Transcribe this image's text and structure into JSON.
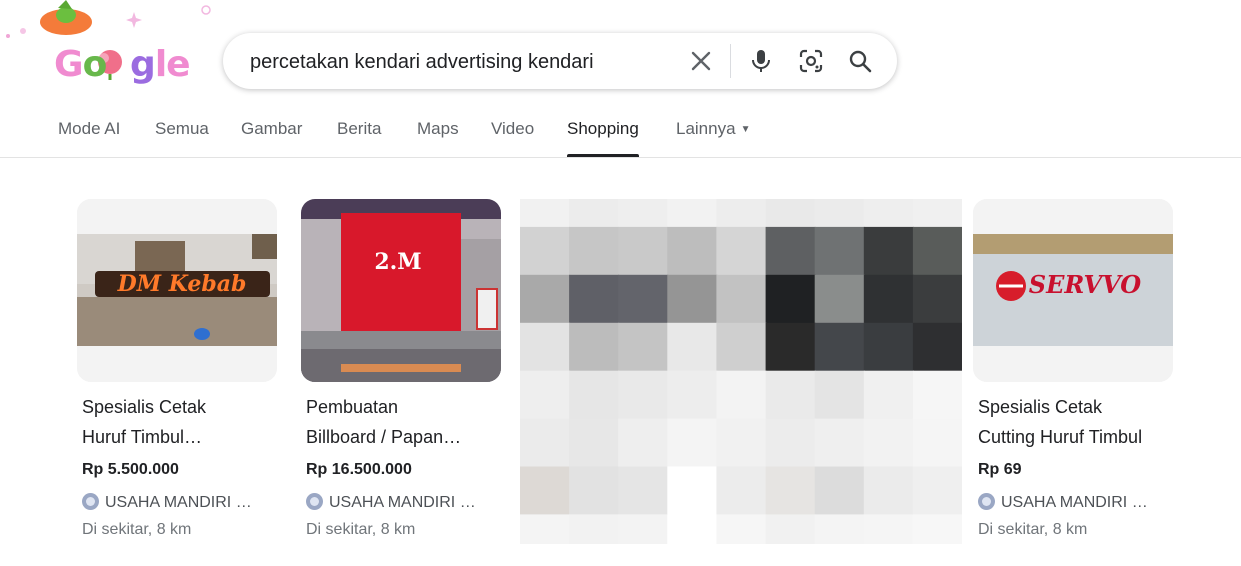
{
  "logo": {
    "text": "Google"
  },
  "search": {
    "query": "percetakan kendari advertising kendari",
    "icons": [
      "close-icon",
      "mic-icon",
      "lens-icon",
      "search-icon"
    ]
  },
  "tabs": [
    {
      "label": "Mode AI"
    },
    {
      "label": "Semua"
    },
    {
      "label": "Gambar"
    },
    {
      "label": "Berita"
    },
    {
      "label": "Maps"
    },
    {
      "label": "Video"
    },
    {
      "label": "Shopping",
      "active": true
    },
    {
      "label": "Lainnya"
    }
  ],
  "products": [
    {
      "title_line1": "Spesialis Cetak",
      "title_line2": "Huruf Timbul…",
      "price": "Rp 5.500.000",
      "seller": "USAHA MANDIRI …",
      "distance": "Di sekitar, 8 km",
      "thumb_text": "DM Kebab"
    },
    {
      "title_line1": "Pembuatan",
      "title_line2": "Billboard / Papan…",
      "price": "Rp 16.500.000",
      "seller": "USAHA MANDIRI …",
      "distance": "Di sekitar, 8 km",
      "thumb_text": "2.M"
    },
    {
      "title_line1": "Spesialis Cetak",
      "title_line2": "Cutting Huruf Timbul",
      "price": "Rp 69",
      "seller": "USAHA MANDIRI …",
      "distance": "Di sekitar, 8 km",
      "thumb_text": "SERVVO"
    }
  ],
  "colors": {
    "accent": "#202124",
    "muted": "#5f6368",
    "brand_blue": "#4285f4",
    "pink": "#f06fb3",
    "green": "#68b84b"
  }
}
